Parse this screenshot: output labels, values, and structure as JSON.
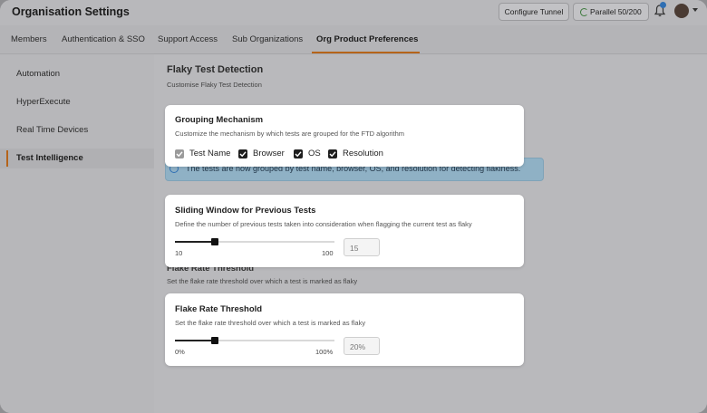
{
  "header": {
    "title": "Organisation Settings",
    "configure_tunnel": "Configure Tunnel",
    "parallel": "Parallel 50/200"
  },
  "tabs": [
    {
      "label": "Members"
    },
    {
      "label": "Authentication & SSO"
    },
    {
      "label": "Support Access"
    },
    {
      "label": "Sub Organizations"
    },
    {
      "label": "Org Product Preferences",
      "active": true
    }
  ],
  "sidebar": {
    "items": [
      {
        "label": "Automation"
      },
      {
        "label": "HyperExecute"
      },
      {
        "label": "Real Time Devices"
      },
      {
        "label": "Test Intelligence",
        "active": true
      }
    ]
  },
  "main": {
    "title": "Flaky Test Detection",
    "subtitle": "Customise Flaky Test Detection",
    "info_banner": "The tests are now grouped by test name, browser, OS, and resolution for detecting flakiness.",
    "bg_label": "Flake Rate Threshold",
    "bg_desc": "Set the flake rate threshold over which a test is marked as flaky"
  },
  "grouping": {
    "title": "Grouping Mechanism",
    "desc": "Customize the mechanism by which tests are grouped for the FTD algorithm",
    "options": [
      {
        "label": "Test Name",
        "checked": true,
        "disabled": true
      },
      {
        "label": "Browser",
        "checked": true
      },
      {
        "label": "OS",
        "checked": true
      },
      {
        "label": "Resolution",
        "checked": true
      }
    ]
  },
  "sliding_window": {
    "title": "Sliding Window for Previous Tests",
    "desc": "Define the number of previous tests taken into consideration when flagging the current test as flaky",
    "min_label": "10",
    "max_label": "100",
    "value": "15",
    "fill_fraction": 0.25
  },
  "flake_rate": {
    "title": "Flake Rate Threshold",
    "desc": "Set the flake rate threshold over which a test is marked as flaky",
    "min_label": "0%",
    "max_label": "100%",
    "value": "20%",
    "fill_fraction": 0.25
  },
  "colors": {
    "accent": "#b5641a",
    "info": "#2f6fb3"
  }
}
